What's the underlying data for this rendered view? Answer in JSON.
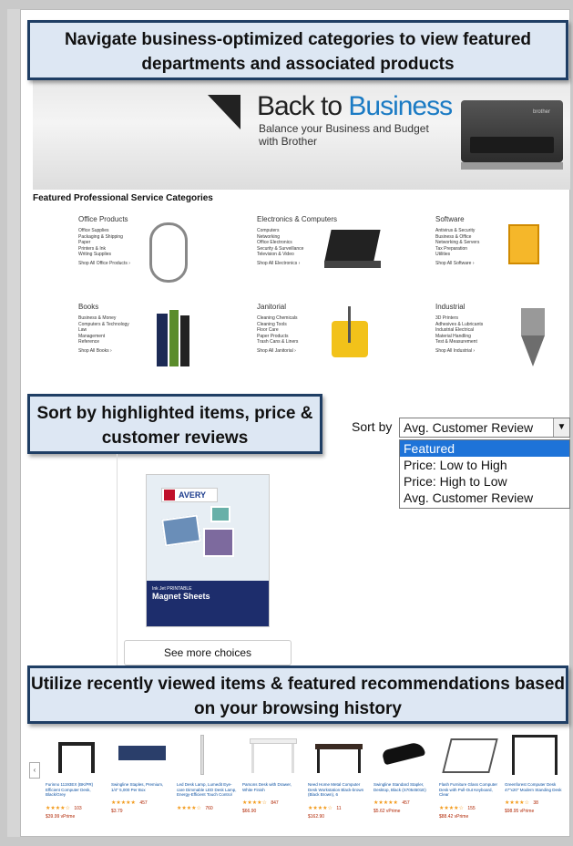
{
  "callouts": {
    "top": "Navigate business-optimized categories to view featured departments and associated products",
    "sort": "Sort by highlighted items, price & customer reviews",
    "bottom": "Utilize recently viewed items & featured recommendations based on your browsing history"
  },
  "banner": {
    "title_a": "Back to ",
    "title_b": "Business",
    "subtitle": "Balance your Business and Budget with Brother",
    "printer_brand": "brother"
  },
  "featured": {
    "title": "Featured Professional Service Categories",
    "categories": [
      {
        "name": "Office Products",
        "items": [
          "Office Supplies",
          "Packaging & Shipping",
          "Paper",
          "Printers & Ink",
          "Writing Supplies"
        ],
        "shop": "Shop All Office Products ›"
      },
      {
        "name": "Electronics & Computers",
        "items": [
          "Computers",
          "Networking",
          "Office Electronics",
          "Security & Surveillance",
          "Television & Video"
        ],
        "shop": "Shop All Electronics ›"
      },
      {
        "name": "Software",
        "items": [
          "Antivirus & Security",
          "Business & Office",
          "Networking & Servers",
          "Tax Preparation",
          "Utilities"
        ],
        "shop": "Shop All Software ›"
      },
      {
        "name": "Books",
        "items": [
          "Business & Money",
          "Computers & Technology",
          "Law",
          "Management",
          "Reference"
        ],
        "shop": "Shop All Books ›"
      },
      {
        "name": "Janitorial",
        "items": [
          "Cleaning Chemicals",
          "Cleaning Tools",
          "Floor Care",
          "Paper Products",
          "Trash Cans & Liners"
        ],
        "shop": "Shop All Janitorial ›"
      },
      {
        "name": "Industrial",
        "items": [
          "3D Printers",
          "Adhesives & Lubricants",
          "Industrial Electrical",
          "Material Handling",
          "Test & Measurement"
        ],
        "shop": "Shop All Industrial ›"
      }
    ]
  },
  "sort": {
    "label": "Sort by",
    "selected": "Avg. Customer Review",
    "options": [
      "Featured",
      "Price: Low to High",
      "Price: High to Low",
      "Avg. Customer Review"
    ],
    "highlighted_option": "Featured"
  },
  "product": {
    "brand": "AVERY",
    "line1": "Ink Jet PRINTABLE",
    "line2": "Magnet Sheets",
    "see_more": "See more choices"
  },
  "recent_items": [
    {
      "title": "Furinno 11193EX (BK/PR) Efficient Computer Desk, Black/Grey",
      "stars": "★★★★☆",
      "count": "103",
      "price": "$39.99 vPrime"
    },
    {
      "title": "Swingline Staples, Premium, 1/4\" 5,000 Per Box",
      "stars": "★★★★★",
      "count": "457",
      "price": "$3.79"
    },
    {
      "title": "Led Desk Lamp, Lumedit Eye-care Dimmable LED Desk Lamp, Energy-Efficient Touch Control",
      "stars": "★★★★☆",
      "count": "760",
      "price": ""
    },
    {
      "title": "Parsons Desk with Drawer, White Finish",
      "stars": "★★★★☆",
      "count": "847",
      "price": "$66.90"
    },
    {
      "title": "Need Home Metal Computer Desk Workstation Black-brown (Black Brown), 6",
      "stars": "★★★★☆",
      "count": "11",
      "price": "$162.90"
    },
    {
      "title": "Swingline Standard Stapler, Desktop, Black (S7054501E)",
      "stars": "★★★★★",
      "count": "457",
      "price": "$5.62 vPrime"
    },
    {
      "title": "Flash Furniture Glass Computer Desk with Pull-Out Keyboard, Clear",
      "stars": "★★★★☆",
      "count": "155",
      "price": "$88.42 vPrime"
    },
    {
      "title": "Greenforest Computer Desk 47\"x20\" Modern Standing Desk",
      "stars": "★★★★☆",
      "count": "38",
      "price": "$98.95 vPrime"
    }
  ],
  "colors": {
    "callout_fill": "#dde7f3",
    "callout_border": "#1f3e64",
    "selected_option": "#1e73d8",
    "brand_blue": "#1b7bc4"
  }
}
